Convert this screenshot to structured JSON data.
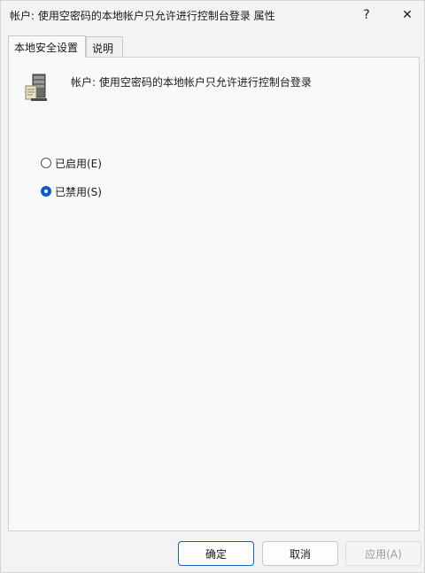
{
  "window": {
    "title": "帐户: 使用空密码的本地帐户只允许进行控制台登录 属性",
    "help_label": "?",
    "close_label": "✕"
  },
  "tabs": [
    {
      "label": "本地安全设置",
      "active": true
    },
    {
      "label": "说明",
      "active": false
    }
  ],
  "policy": {
    "icon": "server-policy-icon",
    "title": "帐户: 使用空密码的本地帐户只允许进行控制台登录"
  },
  "options": [
    {
      "label": "已启用(E)",
      "checked": false
    },
    {
      "label": "已禁用(S)",
      "checked": true
    }
  ],
  "buttons": {
    "ok": "确定",
    "cancel": "取消",
    "apply": "应用(A)"
  },
  "colors": {
    "accent": "#0a5cc7"
  }
}
